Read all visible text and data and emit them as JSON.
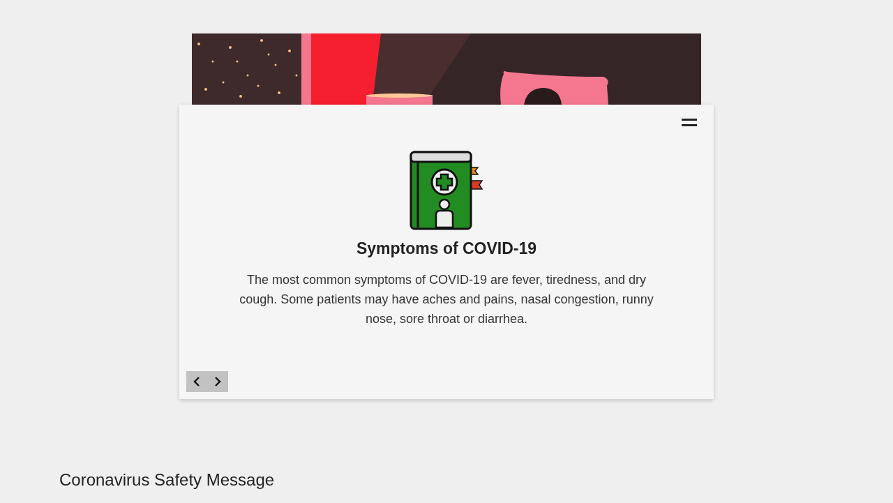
{
  "slide": {
    "title": "Symptoms of COVID-19",
    "text": "The most common symptoms of COVID-19 are fever, tiredness, and dry cough. Some patients may have aches and pains, nasal congestion, runny nose, sore throat or diarrhea."
  },
  "footer": {
    "title": "Coronavirus Safety Message"
  }
}
